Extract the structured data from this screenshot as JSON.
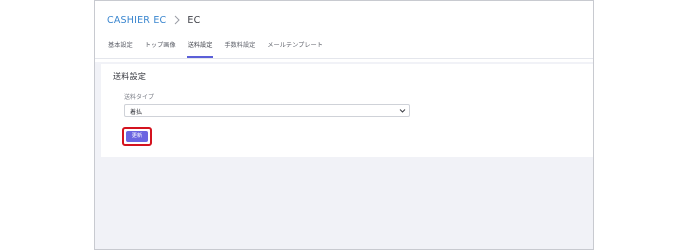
{
  "breadcrumb": {
    "parent": "CASHIER EC",
    "current": "EC"
  },
  "tabs": [
    {
      "label": "基本設定"
    },
    {
      "label": "トップ画像"
    },
    {
      "label": "送料設定"
    },
    {
      "label": "手数料設定"
    },
    {
      "label": "メールテンプレート"
    }
  ],
  "active_tab": "送料設定",
  "section": {
    "title": "送料設定",
    "field_label": "送料タイプ",
    "select_value": "着払",
    "update_label": "更新"
  },
  "colors": {
    "link": "#3a86cf",
    "accent": "#6b66e1",
    "highlight": "#d4131f",
    "background": "#f1f2f7"
  },
  "icons": {
    "separator": "chevron-right-icon",
    "select_arrow": "chevron-down-icon"
  }
}
